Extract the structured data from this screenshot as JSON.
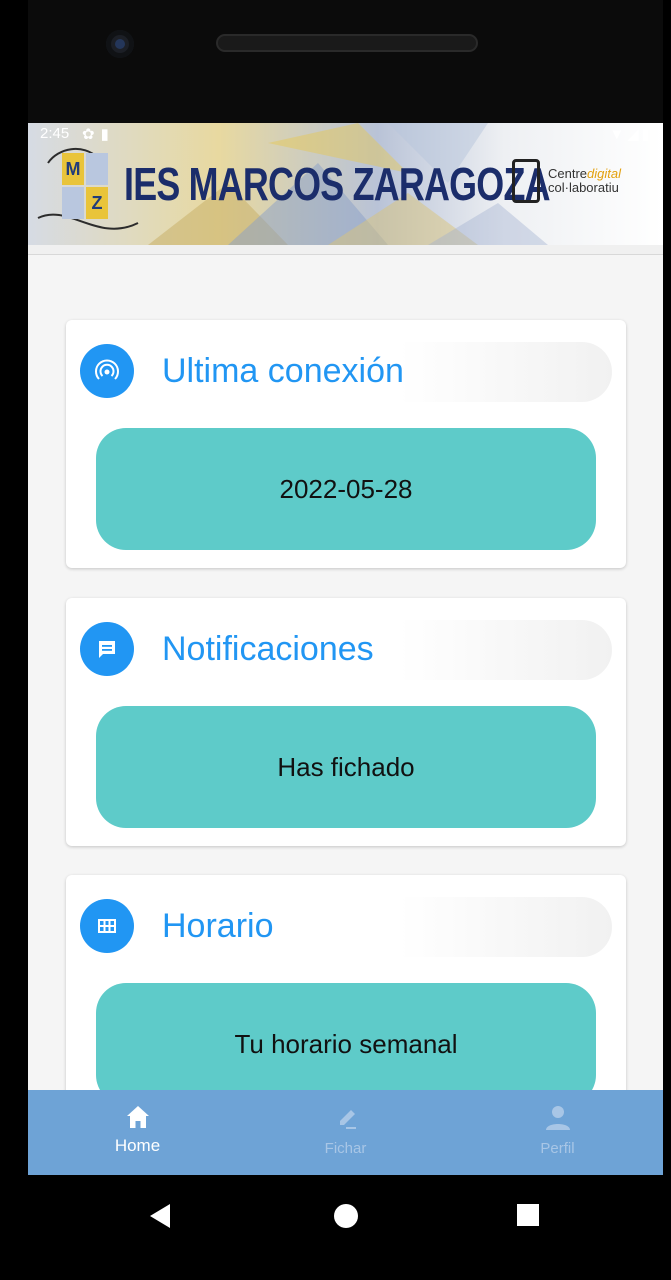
{
  "status_bar": {
    "time": "2:45"
  },
  "header": {
    "school_name": "IES MARCOS ZARAGOZA",
    "logo_letters": [
      "M",
      "Z"
    ],
    "badge_line1_a": "Centre",
    "badge_line1_b": "digital",
    "badge_line2": "col·laboratiu"
  },
  "cards": [
    {
      "title": "Ultima conexión",
      "icon": "wifi-signal-icon",
      "body": "2022-05-28"
    },
    {
      "title": "Notificaciones",
      "icon": "message-icon",
      "body": "Has fichado"
    },
    {
      "title": "Horario",
      "icon": "grid-icon",
      "body": "Tu horario semanal"
    }
  ],
  "bottom_nav": [
    {
      "label": "Home",
      "icon": "home-icon",
      "active": true
    },
    {
      "label": "Fichar",
      "icon": "pencil-icon",
      "active": false
    },
    {
      "label": "Perfil",
      "icon": "person-icon",
      "active": false
    }
  ],
  "colors": {
    "primary": "#2196f3",
    "card_body": "#5ecbc9",
    "nav_background": "#6ea3d6",
    "title_text": "#1b2d6b"
  }
}
